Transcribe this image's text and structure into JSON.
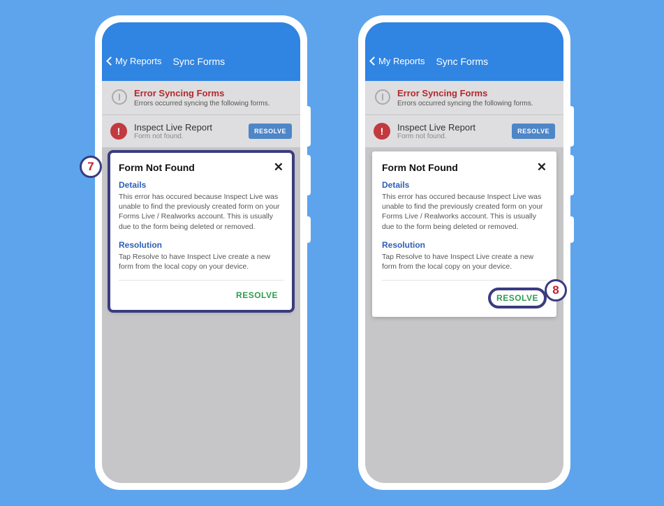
{
  "callouts": {
    "seven": "7",
    "eight": "8"
  },
  "nav": {
    "back": "My Reports",
    "title": "Sync Forms"
  },
  "banner": {
    "title": "Error Syncing Forms",
    "subtitle": "Errors occurred syncing the following forms."
  },
  "item": {
    "title": "Inspect Live Report",
    "subtitle": "Form not found.",
    "action": "RESOLVE"
  },
  "card": {
    "title": "Form Not Found",
    "details_label": "Details",
    "details_body": "This error has occured because Inspect Live was unable to find the previously created form on your Forms Live / Realworks account. This is usually due to the form being deleted or removed.",
    "resolution_label": "Resolution",
    "resolution_body": "Tap Resolve to have Inspect Live create a new form from the local copy on your device.",
    "resolve": "RESOLVE"
  }
}
